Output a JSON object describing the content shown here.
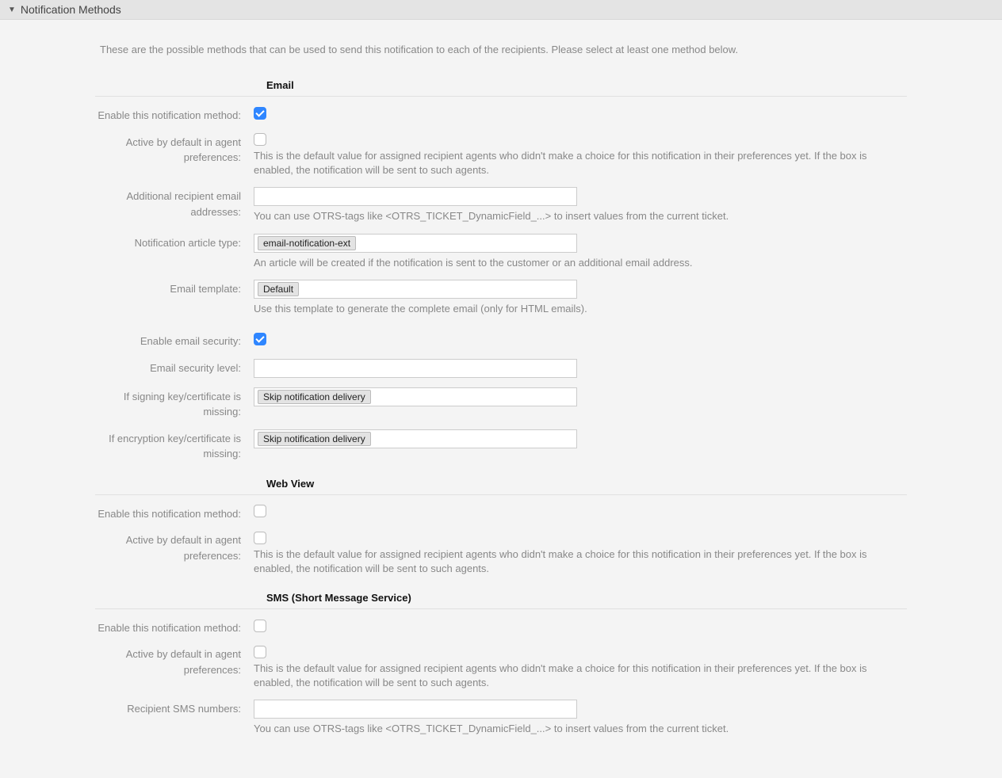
{
  "header": {
    "title": "Notification Methods"
  },
  "intro": "These are the possible methods that can be used to send this notification to each of the recipients. Please select at least one method below.",
  "email": {
    "title": "Email",
    "enable_label": "Enable this notification method:",
    "enable_checked": true,
    "active_default_label": "Active by default in agent preferences:",
    "active_default_checked": false,
    "active_default_help": "This is the default value for assigned recipient agents who didn't make a choice for this notification in their preferences yet. If the box is enabled, the notification will be sent to such agents.",
    "additional_recipients_label": "Additional recipient email addresses:",
    "additional_recipients_value": "",
    "additional_recipients_help": "You can use OTRS-tags like <OTRS_TICKET_DynamicField_...> to insert values from the current ticket.",
    "article_type_label": "Notification article type:",
    "article_type_value": "email-notification-ext",
    "article_type_help": "An article will be created if the notification is sent to the customer or an additional email address.",
    "template_label": "Email template:",
    "template_value": "Default",
    "template_help": "Use this template to generate the complete email (only for HTML emails).",
    "security_enable_label": "Enable email security:",
    "security_enable_checked": true,
    "security_level_label": "Email security level:",
    "security_level_value": "",
    "signing_missing_label": "If signing key/certificate is missing:",
    "signing_missing_value": "Skip notification delivery",
    "encryption_missing_label": "If encryption key/certificate is missing:",
    "encryption_missing_value": "Skip notification delivery"
  },
  "webview": {
    "title": "Web View",
    "enable_label": "Enable this notification method:",
    "enable_checked": false,
    "active_default_label": "Active by default in agent preferences:",
    "active_default_checked": false,
    "active_default_help": "This is the default value for assigned recipient agents who didn't make a choice for this notification in their preferences yet. If the box is enabled, the notification will be sent to such agents."
  },
  "sms": {
    "title": "SMS (Short Message Service)",
    "enable_label": "Enable this notification method:",
    "enable_checked": false,
    "active_default_label": "Active by default in agent preferences:",
    "active_default_checked": false,
    "active_default_help": "This is the default value for assigned recipient agents who didn't make a choice for this notification in their preferences yet. If the box is enabled, the notification will be sent to such agents.",
    "recipient_numbers_label": "Recipient SMS numbers:",
    "recipient_numbers_value": "",
    "recipient_numbers_help": "You can use OTRS-tags like <OTRS_TICKET_DynamicField_...> to insert values from the current ticket."
  }
}
